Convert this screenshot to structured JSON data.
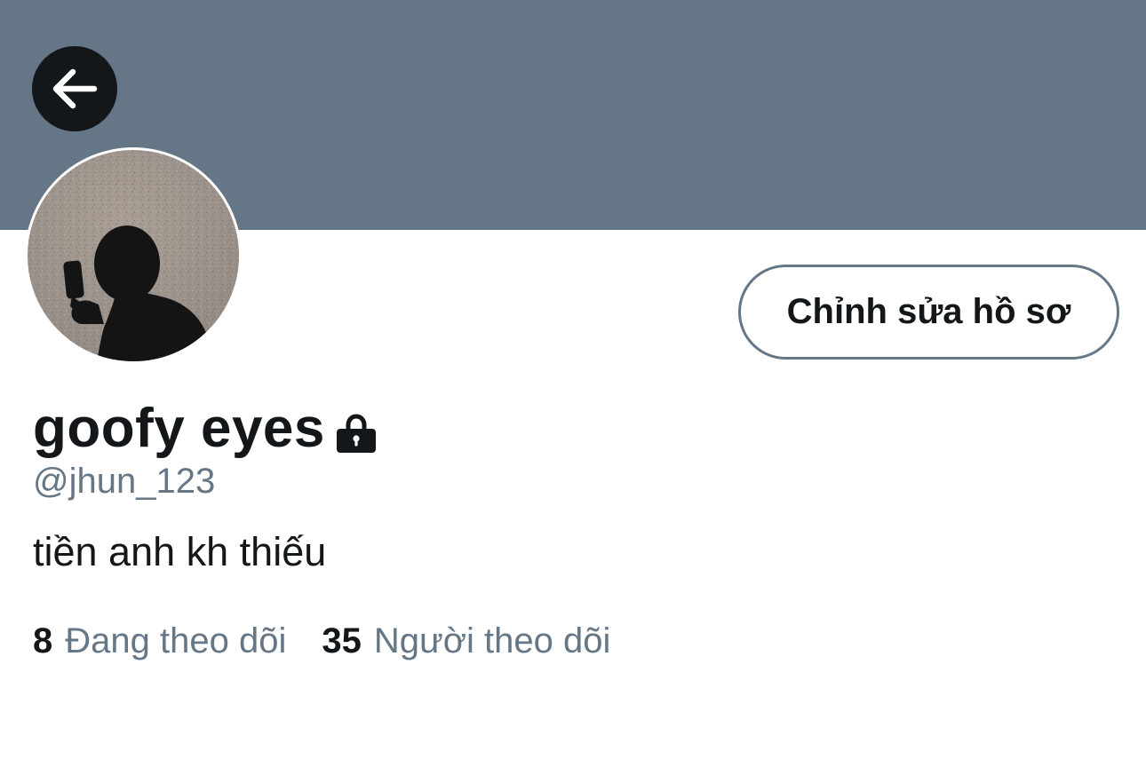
{
  "profile": {
    "display_name": "goofy eyes",
    "handle": "@jhun_123",
    "bio": "tiền anh kh thiếu",
    "protected": true
  },
  "actions": {
    "edit_profile_label": "Chỉnh sửa hồ sơ"
  },
  "stats": {
    "following_count": "8",
    "following_label": "Đang theo dõi",
    "followers_count": "35",
    "followers_label": "Người theo dõi"
  },
  "icons": {
    "back": "arrow-left-icon",
    "lock": "lock-icon"
  },
  "colors": {
    "banner": "#657786",
    "primary_text": "#14171a",
    "secondary_text": "#657786",
    "back_button_bg": "#14171a"
  }
}
